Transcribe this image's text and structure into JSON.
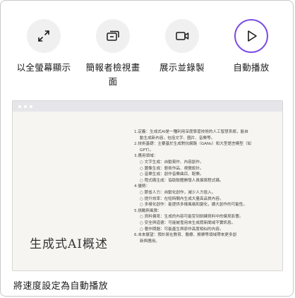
{
  "options": [
    {
      "label": "以全螢幕顯示",
      "icon": "expand-arrows-icon",
      "selected": false
    },
    {
      "label": "簡報者檢視畫面",
      "icon": "presenter-view-icon",
      "selected": false
    },
    {
      "label": "展示並錄製",
      "icon": "video-camera-icon",
      "selected": false
    },
    {
      "label": "自動播放",
      "icon": "play-icon",
      "selected": true
    }
  ],
  "accent_color": "#7e4ee6",
  "preview": {
    "slide_title": "生成式AI概述",
    "lines": [
      "1.定義：生成式AI是一種利用深度學習技術的人工智慧系統，能自",
      "動生成新內容，包括文字、圖片、音樂等。",
      "2.技術基礎：主要基於生成對抗網路（GANs）和大型語言模型（如",
      "GPT）。",
      "3.應用領域：",
      "○ 文字生成：自動寫作、內容創作。",
      "○ 圖像生成：藝術作品、視覺設計。",
      "○ 音樂生成：創作音樂曲目、配樂。",
      "○ 程式碼生成：協助軟體開發人員撰寫程式碼。",
      "4.優勢：",
      "○ 節省人力：自動化創作，減少人力投入。",
      "○ 提升效率：在短時間內生成大量高品質內容。",
      "○ 多樣化創作：能提供多樣風格和變化，擴大創作的可能性。",
      "5.挑戰與風險：",
      "○ 資料偏見：生成的內容可能受到訓練資料中的偏見影響。",
      "○ 安全與道德：可能被濫用來生成假新聞或不實訊息。",
      "○ 著作問題：可能產生與原作高度相似的內容。",
      "6.未來展望：預計將在教育、醫療、娛樂等領域帶來更多創",
      "新與應用。"
    ]
  },
  "footer_text": "將速度設定為自動播放"
}
